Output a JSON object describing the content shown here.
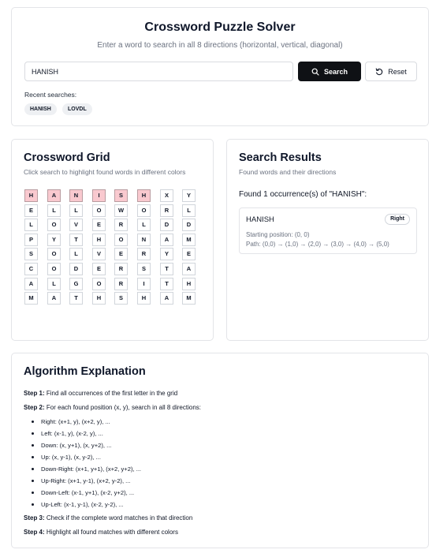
{
  "header": {
    "title": "Crossword Puzzle Solver",
    "subtitle": "Enter a word to search in all 8 directions (horizontal, vertical, diagonal)",
    "search_value": "HANISH",
    "search_label": "Search",
    "reset_label": "Reset",
    "recent_label": "Recent searches:",
    "recent": [
      "HANISH",
      "LOVDL"
    ]
  },
  "grid_panel": {
    "title": "Crossword Grid",
    "subtitle": "Click search to highlight found words in different colors",
    "rows": [
      [
        "H",
        "A",
        "N",
        "I",
        "S",
        "H",
        "X",
        "Y"
      ],
      [
        "E",
        "L",
        "L",
        "O",
        "W",
        "O",
        "R",
        "L"
      ],
      [
        "L",
        "O",
        "V",
        "E",
        "R",
        "L",
        "D",
        "D"
      ],
      [
        "P",
        "Y",
        "T",
        "H",
        "O",
        "N",
        "A",
        "M"
      ],
      [
        "S",
        "O",
        "L",
        "V",
        "E",
        "R",
        "Y",
        "E"
      ],
      [
        "C",
        "O",
        "D",
        "E",
        "R",
        "S",
        "T",
        "A"
      ],
      [
        "A",
        "L",
        "G",
        "O",
        "R",
        "I",
        "T",
        "H"
      ],
      [
        "M",
        "A",
        "T",
        "H",
        "S",
        "H",
        "A",
        "M"
      ]
    ],
    "highlight_color": "#f9c9cf",
    "highlighted": [
      [
        0,
        0
      ],
      [
        0,
        1
      ],
      [
        0,
        2
      ],
      [
        0,
        3
      ],
      [
        0,
        4
      ],
      [
        0,
        5
      ]
    ]
  },
  "results_panel": {
    "title": "Search Results",
    "subtitle": "Found words and their directions",
    "found_text": "Found 1 occurrence(s) of \"HANISH\":",
    "results": [
      {
        "word": "HANISH",
        "direction": "Right",
        "start": "Starting position: (0, 0)",
        "path": "Path: (0,0) → (1,0) → (2,0) → (3,0) → (4,0) → (5,0)"
      }
    ]
  },
  "algorithm": {
    "title": "Algorithm Explanation",
    "step1_label": "Step 1:",
    "step1_text": " Find all occurrences of the first letter in the grid",
    "step2_label": "Step 2:",
    "step2_text": " For each found position (x, y), search in all 8 directions:",
    "directions": [
      "Right: (x+1, y), (x+2, y), ...",
      "Left: (x-1, y), (x-2, y), ...",
      "Down: (x, y+1), (x, y+2), ...",
      "Up: (x, y-1), (x, y-2), ...",
      "Down-Right: (x+1, y+1), (x+2, y+2), ...",
      "Up-Right: (x+1, y-1), (x+2, y-2), ...",
      "Down-Left: (x-1, y+1), (x-2, y+2), ...",
      "Up-Left: (x-1, y-1), (x-2, y-2), ..."
    ],
    "step3_label": "Step 3:",
    "step3_text": " Check if the complete word matches in that direction",
    "step4_label": "Step 4:",
    "step4_text": " Highlight all found matches with different colors"
  }
}
